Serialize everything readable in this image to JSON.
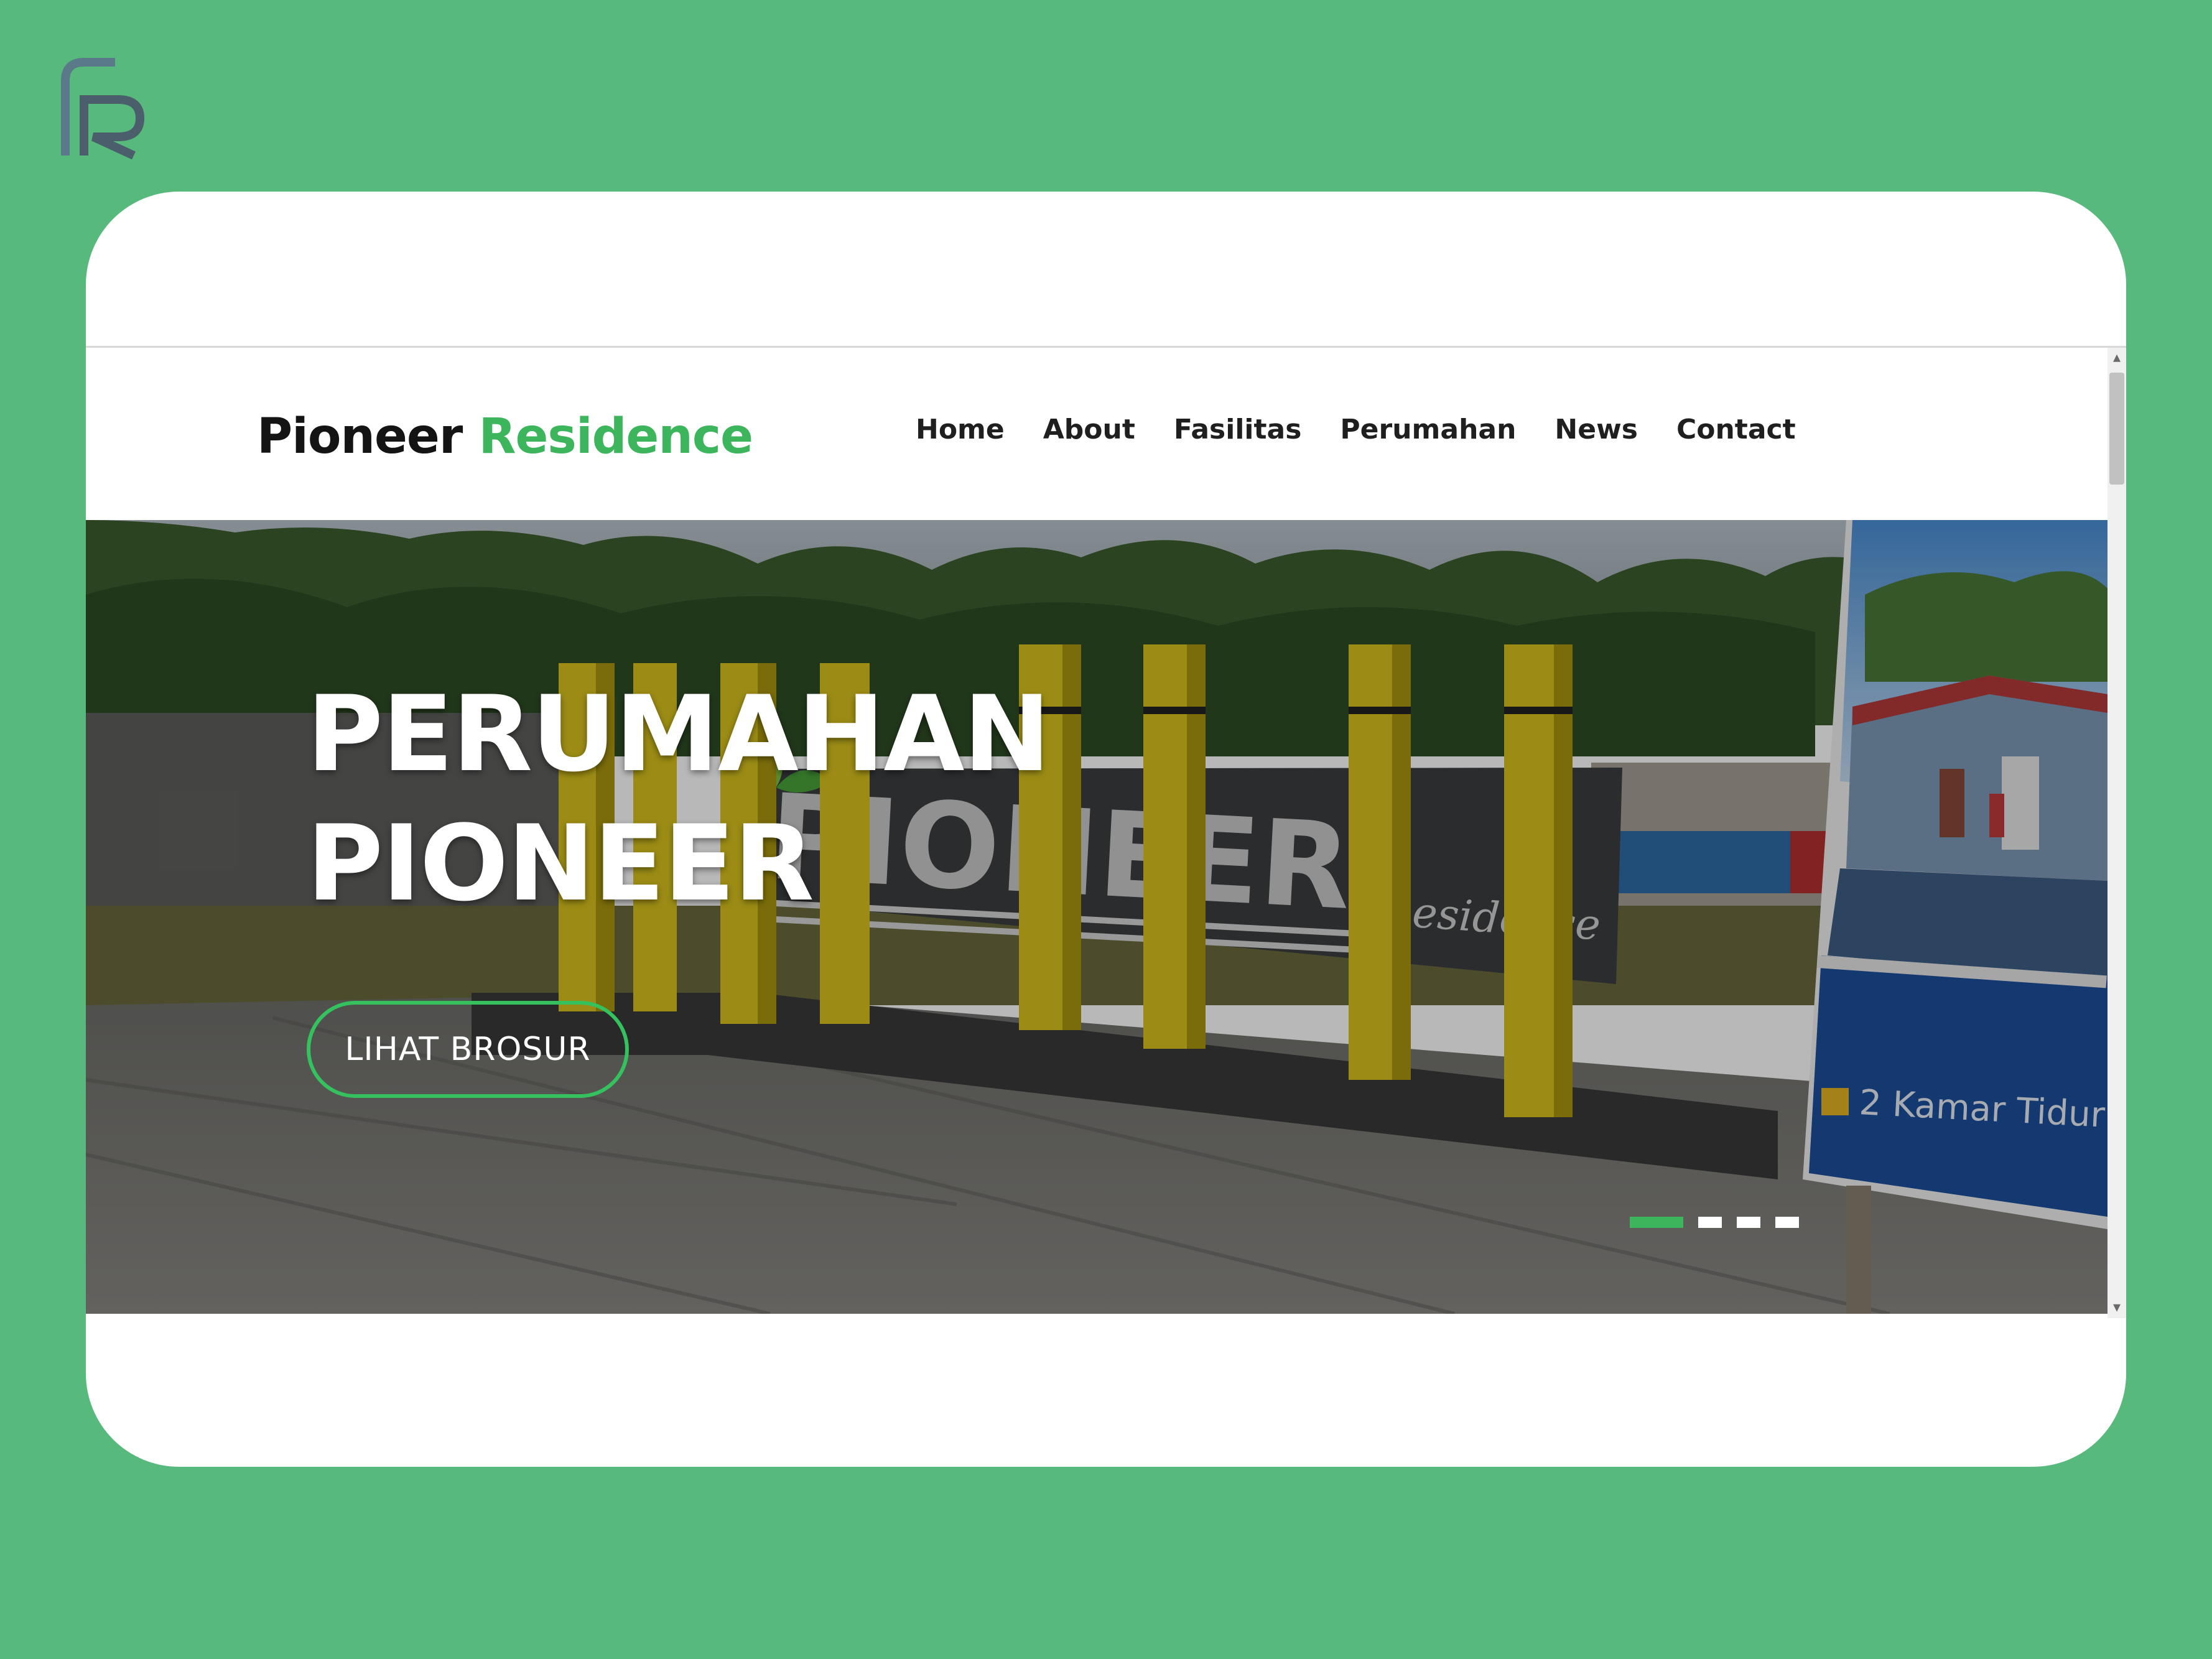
{
  "brand": {
    "word1": "Pioneer",
    "word2": "Residence"
  },
  "nav": {
    "items": [
      {
        "label": "Home"
      },
      {
        "label": "About"
      },
      {
        "label": "Fasilitas"
      },
      {
        "label": "Perumahan"
      },
      {
        "label": "News"
      },
      {
        "label": "Contact"
      }
    ]
  },
  "hero": {
    "title_line1": "PERUMAHAN",
    "title_line2": "PIONEER",
    "button_label": "LIHAT BROSUR",
    "photo_sign_text": "PIONEER",
    "photo_sign_subtext": "Residence",
    "photo_banner_text": "2 Kamar Tidur",
    "slides": {
      "count": 4,
      "active": 1
    }
  },
  "colors": {
    "background": "#57b97c",
    "accent": "#3cb55c",
    "card": "#ffffff"
  },
  "icons": {
    "logo": "pr-logo-icon",
    "scroll_up": "chevron-up-icon",
    "scroll_down": "chevron-down-icon"
  }
}
